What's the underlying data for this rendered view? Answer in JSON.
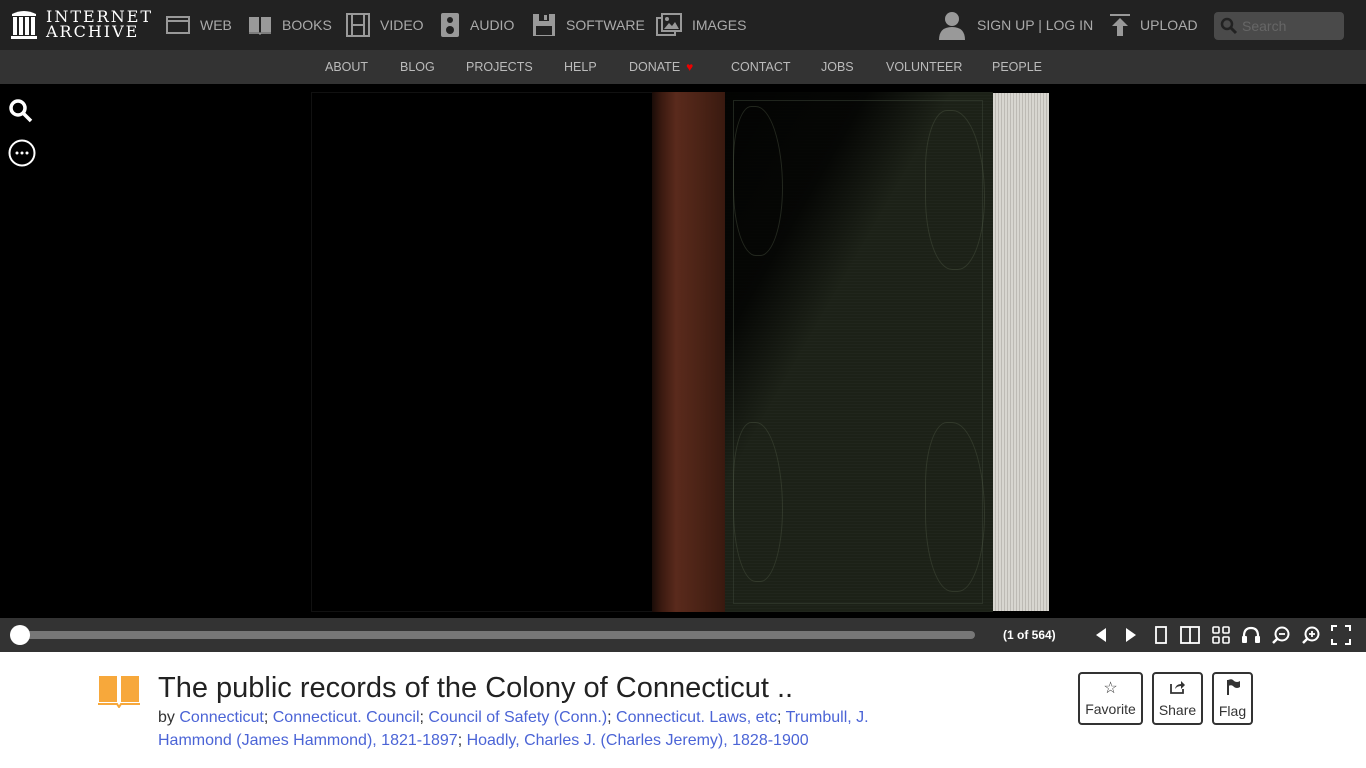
{
  "topnav": {
    "logo_line1": "INTERNET",
    "logo_line2": "ARCHIVE",
    "items": [
      {
        "label": "WEB",
        "icon": "web-icon"
      },
      {
        "label": "BOOKS",
        "icon": "books-icon"
      },
      {
        "label": "VIDEO",
        "icon": "video-icon"
      },
      {
        "label": "AUDIO",
        "icon": "audio-icon"
      },
      {
        "label": "SOFTWARE",
        "icon": "software-icon"
      },
      {
        "label": "IMAGES",
        "icon": "images-icon"
      }
    ],
    "signin": "SIGN UP | LOG IN",
    "upload": "UPLOAD",
    "search_placeholder": "Search"
  },
  "subnav": {
    "items": [
      "ABOUT",
      "BLOG",
      "PROJECTS",
      "HELP",
      "DONATE",
      "CONTACT",
      "JOBS",
      "VOLUNTEER",
      "PEOPLE"
    ]
  },
  "viewer": {
    "side_tools": [
      "search-icon",
      "more-options-icon"
    ],
    "page_current": 1,
    "page_total": 564,
    "page_label": "(1 of 564)",
    "progress_fraction": 0.0
  },
  "controls": [
    "previous-page",
    "next-page",
    "one-page-view",
    "two-page-view",
    "thumbnail-view",
    "read-aloud",
    "zoom-out",
    "zoom-in",
    "fullscreen"
  ],
  "item": {
    "title": "The public records of the Colony of Connecticut ..",
    "by_label": "by",
    "creators": [
      "Connecticut",
      "Connecticut. Council",
      "Council of Safety (Conn.)",
      "Connecticut. Laws, etc",
      "Trumbull, J. Hammond (James Hammond), 1821-1897",
      "Hoadly, Charles J. (Charles Jeremy), 1828-1900"
    ],
    "actions": [
      {
        "label": "Favorite",
        "icon": "star-icon"
      },
      {
        "label": "Share",
        "icon": "share-icon"
      },
      {
        "label": "Flag",
        "icon": "flag-icon"
      }
    ]
  },
  "colors": {
    "topnav_bg": "#222222",
    "subnav_bg": "#333333",
    "link": "#4b64d6",
    "book_icon": "#f7a83b",
    "donate_heart": "#e00000"
  }
}
